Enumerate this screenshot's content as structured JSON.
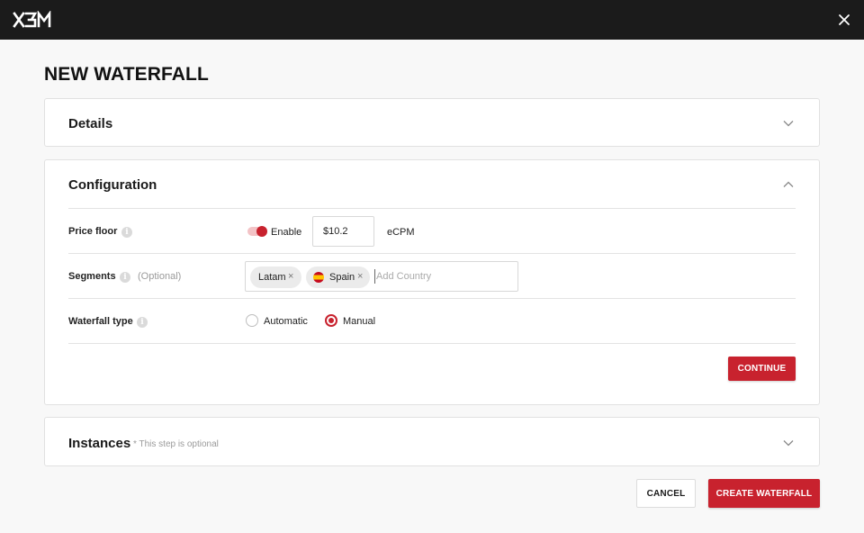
{
  "header": {
    "logo_text": "X3M",
    "logo_icon": "x3m-logo",
    "close_icon": "close-icon"
  },
  "page": {
    "title": "NEW WATERFALL"
  },
  "sections": {
    "details": {
      "title": "Details",
      "expanded": false
    },
    "configuration": {
      "title": "Configuration",
      "expanded": true,
      "price_floor": {
        "label": "Price floor",
        "toggle_label": "Enable",
        "toggle_on": true,
        "value": "$10.2",
        "unit": "eCPM"
      },
      "segments": {
        "label": "Segments",
        "optional": "(Optional)",
        "chips": [
          {
            "label": "Latam",
            "remove": "×"
          },
          {
            "label": "Spain",
            "remove": "×",
            "flag": "spain-flag-icon"
          }
        ],
        "placeholder": "Add Country"
      },
      "waterfall_type": {
        "label": "Waterfall type",
        "options": [
          "Automatic",
          "Manual"
        ],
        "selected": "Manual"
      },
      "continue_label": "CONTINUE"
    },
    "instances": {
      "title": "Instances",
      "note": "* This step is optional",
      "expanded": false
    }
  },
  "footer": {
    "cancel_label": "CANCEL",
    "create_label": "CREATE WATERFALL"
  },
  "colors": {
    "accent": "#c8222e",
    "topbar": "#1b1b1b",
    "background": "#f8f8f8"
  }
}
